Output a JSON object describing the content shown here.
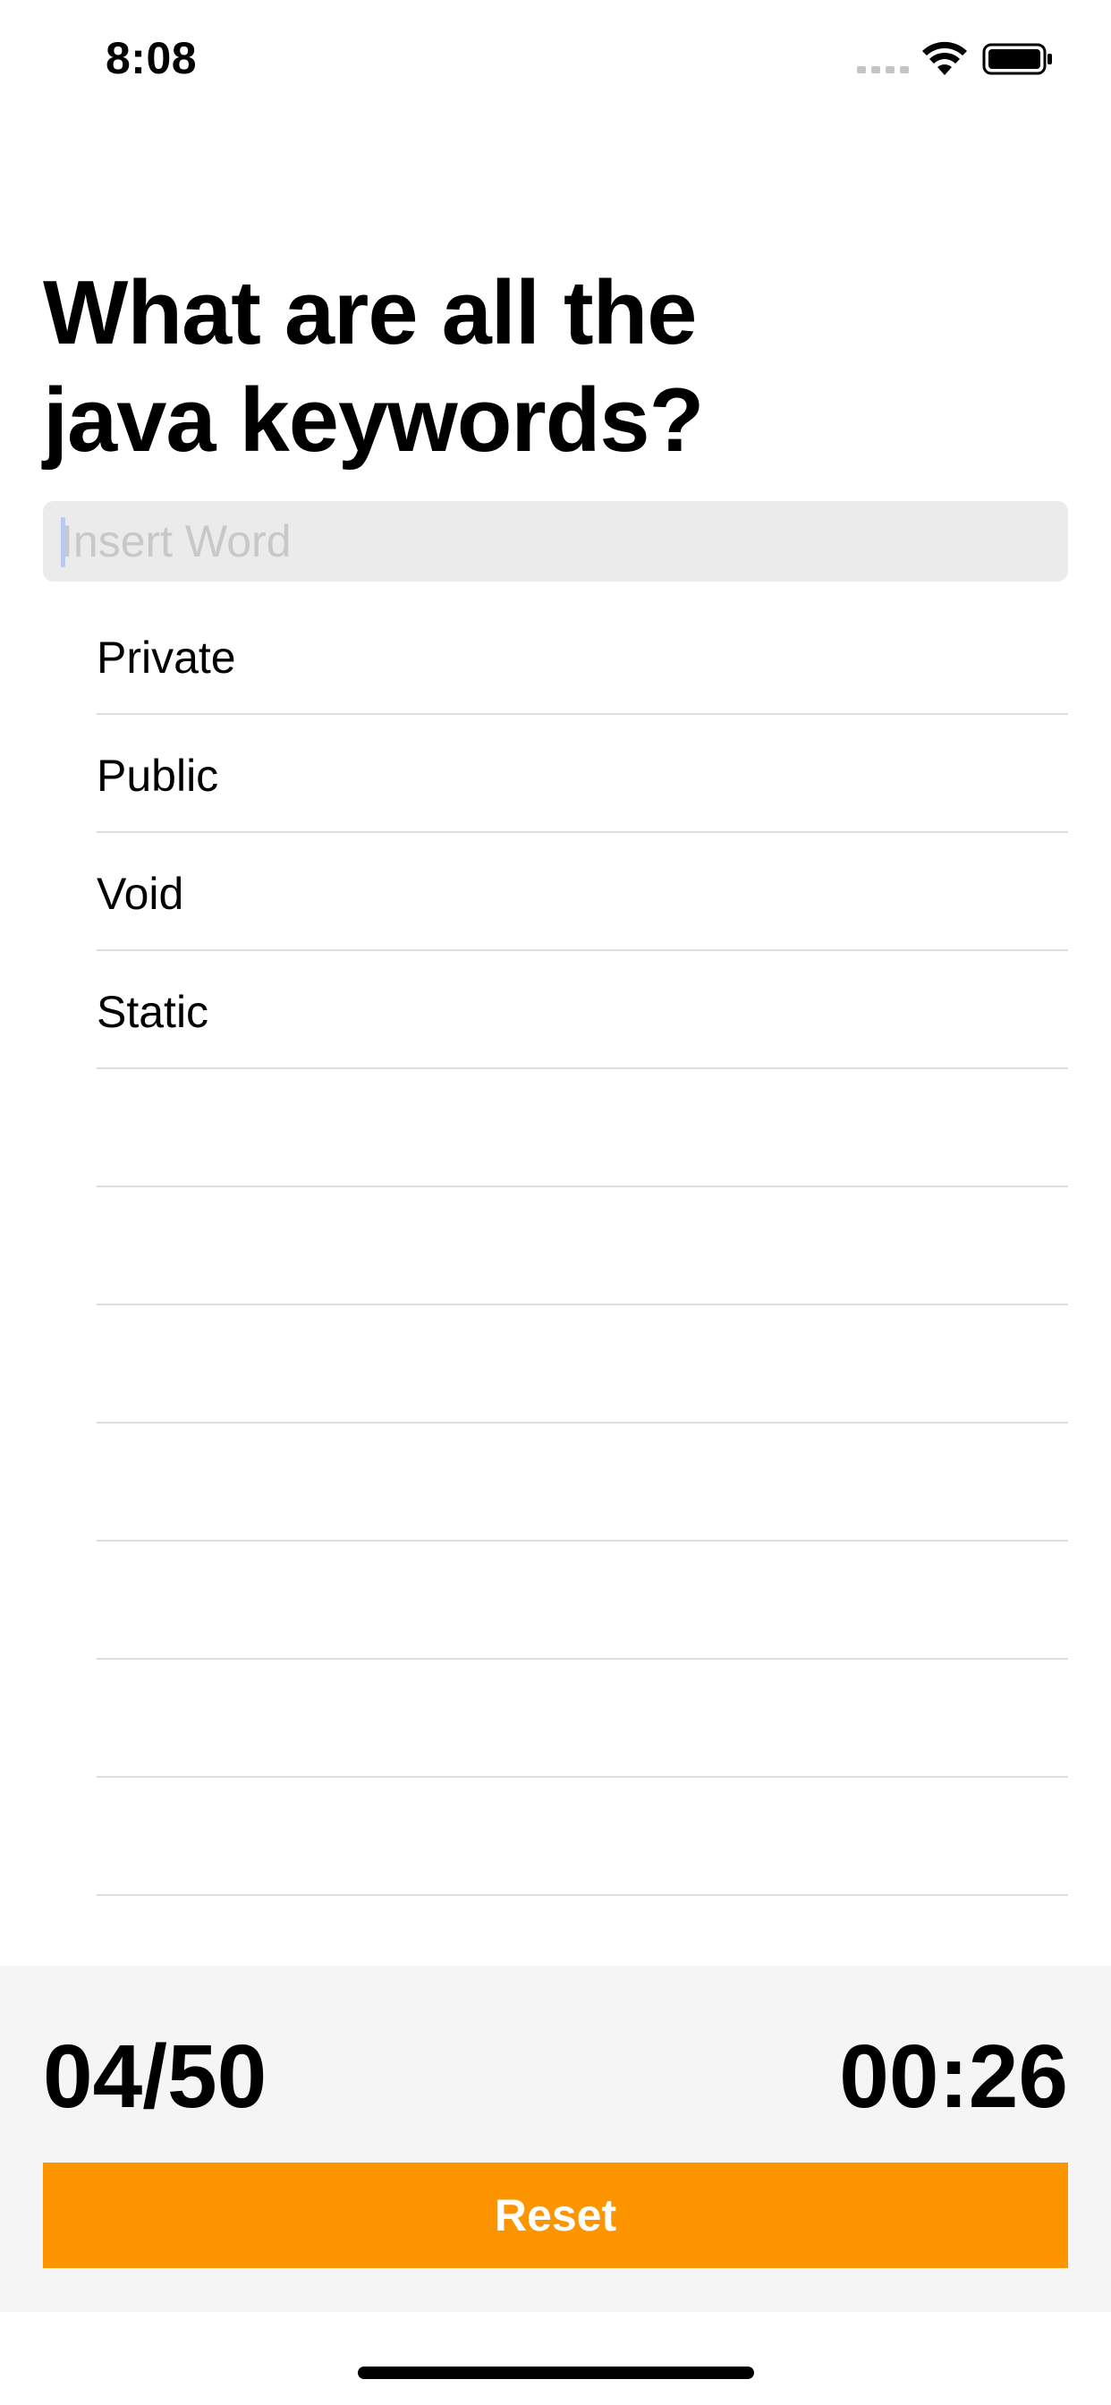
{
  "status_bar": {
    "time": "8:08",
    "icons": [
      "signal-icon",
      "wifi-icon",
      "battery-icon"
    ]
  },
  "title": "What are all the java keywords?",
  "input": {
    "placeholder": "Insert Word",
    "value": ""
  },
  "words": [
    {
      "label": "Private"
    },
    {
      "label": "Public"
    },
    {
      "label": "Void"
    },
    {
      "label": "Static"
    },
    {
      "label": ""
    },
    {
      "label": ""
    },
    {
      "label": ""
    },
    {
      "label": ""
    },
    {
      "label": ""
    },
    {
      "label": ""
    },
    {
      "label": ""
    }
  ],
  "footer": {
    "score": "04/50",
    "timer": "00:26",
    "reset_label": "Reset"
  },
  "colors": {
    "accent": "#fd9500",
    "panel_background": "#f5f5f5",
    "input_background": "#ebebeb"
  }
}
